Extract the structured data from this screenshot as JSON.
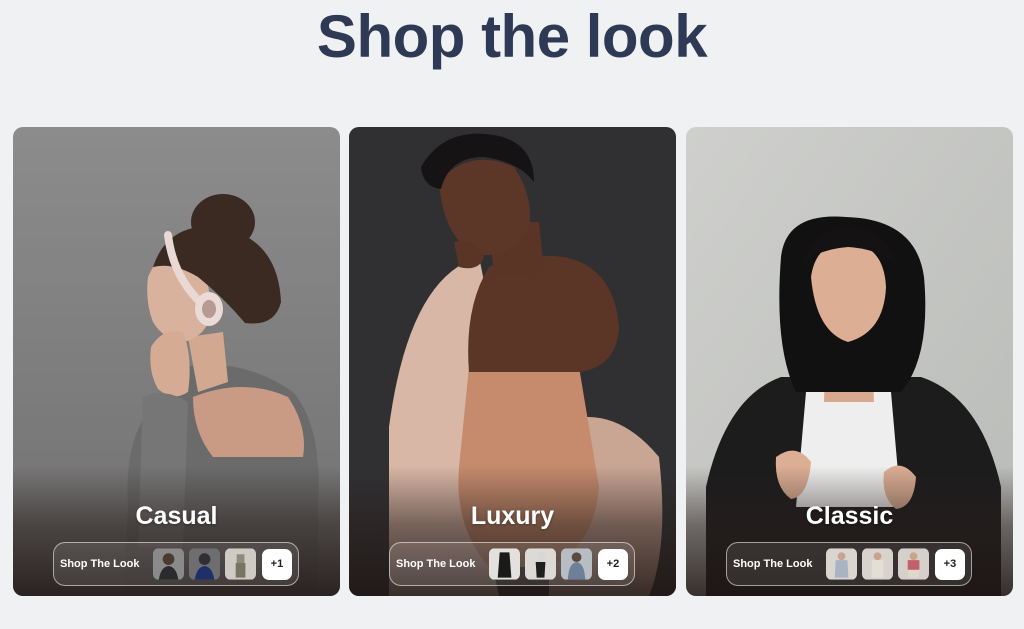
{
  "page": {
    "title": "Shop the look"
  },
  "cards": [
    {
      "title": "Casual",
      "shop_label": "Shop The Look",
      "more": "+1"
    },
    {
      "title": "Luxury",
      "shop_label": "Shop The Look",
      "more": "+2"
    },
    {
      "title": "Classic",
      "shop_label": "Shop The Look",
      "more": "+3"
    }
  ]
}
